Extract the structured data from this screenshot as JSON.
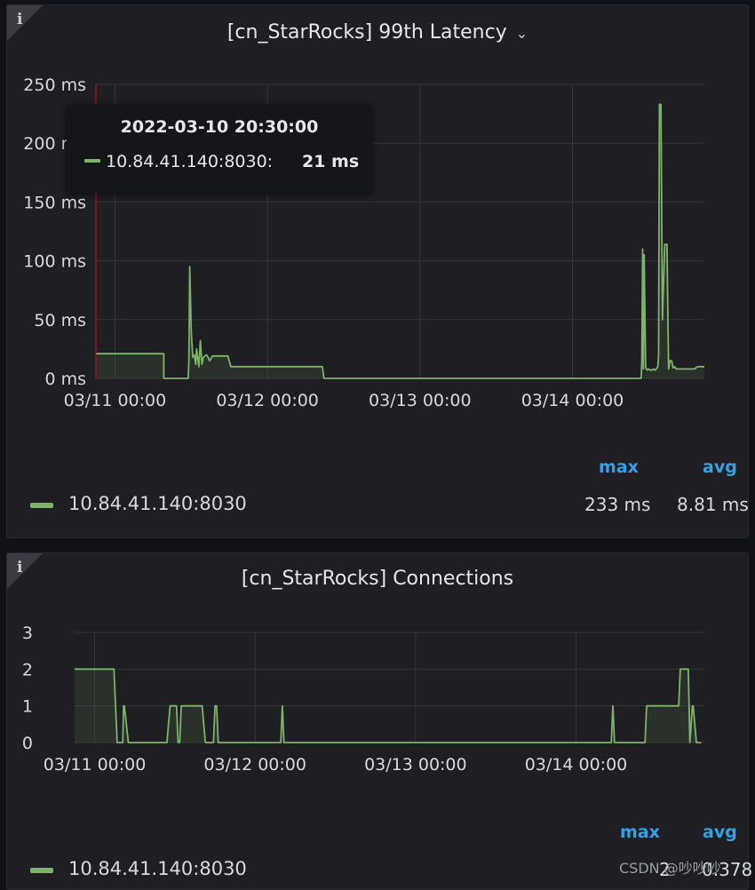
{
  "panels": [
    {
      "title": "[cn_StarRocks] 99th Latency",
      "info_icon": "info-icon",
      "menu_icon": "chevron-down-icon",
      "legend": {
        "headers": [
          "max",
          "avg"
        ],
        "series": "10.84.41.140:8030",
        "max": "233 ms",
        "avg": "8.81 ms"
      },
      "tooltip": {
        "time": "2022-03-10 20:30:00",
        "series": "10.84.41.140:8030:",
        "value": "21 ms"
      }
    },
    {
      "title": "[cn_StarRocks] Connections",
      "info_icon": "info-icon",
      "legend": {
        "headers": [
          "max",
          "avg"
        ],
        "series": "10.84.41.140:8030",
        "max": "2",
        "avg": "0.378"
      }
    }
  ],
  "watermark": "CSDN @吵吵吵",
  "chart_data": [
    {
      "type": "area",
      "title": "[cn_StarRocks] 99th Latency",
      "y_unit": "ms",
      "yticks": [
        "0 ms",
        "50 ms",
        "100 ms",
        "150 ms",
        "200 ms",
        "250 ms"
      ],
      "ylim": [
        0,
        250
      ],
      "xticks": [
        "03/11 00:00",
        "03/12 00:00",
        "03/13 00:00",
        "03/14 00:00"
      ],
      "xlim_days": [
        -0.125,
        3.865
      ],
      "grid": true,
      "color": "#7eb26d",
      "series": [
        {
          "name": "10.84.41.140:8030",
          "x": [
            -0.125,
            0.32,
            0.32,
            0.48,
            0.48,
            0.485,
            0.49,
            0.5,
            0.51,
            0.52,
            0.53,
            0.535,
            0.55,
            0.56,
            0.57,
            0.58,
            0.59,
            0.6,
            0.61,
            0.62,
            0.64,
            0.68,
            0.74,
            0.76,
            1.36,
            1.37,
            3.45,
            3.455,
            3.46,
            3.465,
            3.47,
            3.48,
            3.49,
            3.5,
            3.51,
            3.52,
            3.53,
            3.54,
            3.55,
            3.56,
            3.565,
            3.57,
            3.58,
            3.59,
            3.605,
            3.62,
            3.63,
            3.64,
            3.65,
            3.66,
            3.67,
            3.68,
            3.69,
            3.7,
            3.72,
            3.8,
            3.82,
            3.865
          ],
          "y": [
            21,
            21,
            0,
            0,
            2,
            15,
            95,
            40,
            18,
            20,
            12,
            25,
            10,
            32,
            12,
            18,
            19,
            20,
            18,
            15,
            19,
            19,
            19,
            10,
            10,
            0,
            0,
            15,
            110,
            8,
            105,
            9,
            7,
            8,
            7,
            7,
            8,
            7,
            8,
            10,
            20,
            233,
            233,
            50,
            114,
            114,
            8,
            15,
            15,
            9,
            10,
            8,
            8,
            8,
            8,
            8,
            10,
            10
          ]
        }
      ]
    },
    {
      "type": "area",
      "title": "[cn_StarRocks] Connections",
      "yticks": [
        "0",
        "1",
        "2",
        "3"
      ],
      "ylim": [
        0,
        3
      ],
      "xticks": [
        "03/11 00:00",
        "03/12 00:00",
        "03/13 00:00",
        "03/14 00:00"
      ],
      "xlim_days": [
        -0.125,
        3.8
      ],
      "grid": true,
      "color": "#7eb26d",
      "series": [
        {
          "name": "10.84.41.140:8030",
          "x": [
            -0.125,
            0.12,
            0.14,
            0.175,
            0.18,
            0.185,
            0.21,
            0.23,
            0.45,
            0.47,
            0.51,
            0.52,
            0.53,
            0.54,
            0.55,
            0.67,
            0.69,
            0.74,
            0.75,
            0.76,
            0.77,
            0.78,
            0.8,
            0.81,
            1.16,
            1.17,
            1.18,
            3.22,
            3.23,
            3.24,
            3.43,
            3.44,
            3.64,
            3.65,
            3.7,
            3.71,
            3.725,
            3.73,
            3.75,
            3.76,
            3.775,
            3.78
          ],
          "y": [
            2,
            2,
            0,
            0,
            1,
            1,
            0,
            0,
            0,
            1,
            1,
            0,
            0,
            1,
            1,
            1,
            0,
            0,
            1,
            1,
            0,
            0,
            0,
            0,
            0,
            1,
            0,
            0,
            1,
            0,
            0,
            1,
            1,
            2,
            2,
            0,
            1,
            1,
            0,
            0,
            0,
            0
          ]
        }
      ]
    }
  ]
}
